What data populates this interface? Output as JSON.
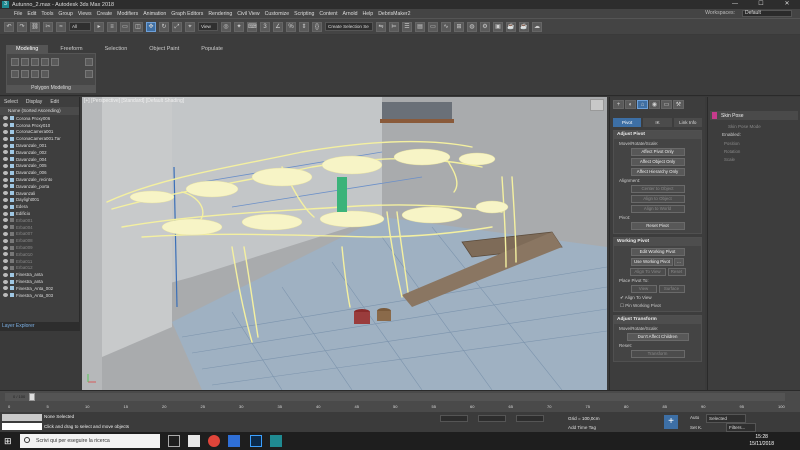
{
  "titlebar": {
    "app_icon": "3",
    "title": "Autunno_2.max - Autodesk 3ds Max 2018",
    "minimize": "—",
    "maximize": "☐",
    "close": "✕"
  },
  "menubar": {
    "items": [
      "File",
      "Edit",
      "Tools",
      "Group",
      "Views",
      "Create",
      "Modifiers",
      "Animation",
      "Graph Editors",
      "Rendering",
      "Civil View",
      "Customize",
      "Scripting",
      "Content",
      "Arnold",
      "Help",
      "DebrisMaker2"
    ],
    "workspaces_label": "Workspaces:",
    "workspace_value": "Default"
  },
  "maintoolbar": {
    "filter_value": "All",
    "view_value": "View",
    "selection_set_placeholder": "Create Selection Se"
  },
  "ribbon": {
    "tabs": [
      "Modeling",
      "Freeform",
      "Selection",
      "Object Paint",
      "Populate"
    ],
    "active_tab": "Modeling",
    "panel_label": "Polygon Modeling"
  },
  "scene_explorer": {
    "menu": [
      "Select",
      "Display",
      "Edit"
    ],
    "header": "Name (Sorted Ascending)",
    "items": [
      {
        "name": "Corona Proxy006",
        "dim": false
      },
      {
        "name": "Corona Proxy010",
        "dim": false
      },
      {
        "name": "CoronaCamera001",
        "dim": false
      },
      {
        "name": "CoronaCamera001.Tar",
        "dim": false
      },
      {
        "name": "Davanzale_001",
        "dim": false
      },
      {
        "name": "Davanzale_002",
        "dim": false
      },
      {
        "name": "Davanzale_004",
        "dim": false
      },
      {
        "name": "Davanzale_005",
        "dim": false
      },
      {
        "name": "Davanzale_006",
        "dim": false
      },
      {
        "name": "Davanzale_recinto",
        "dim": false
      },
      {
        "name": "Davanzale_porta",
        "dim": false
      },
      {
        "name": "Davanzali",
        "dim": false
      },
      {
        "name": "Daylight001",
        "dim": false
      },
      {
        "name": "Edera",
        "dim": false
      },
      {
        "name": "Edificio",
        "dim": false
      },
      {
        "name": "Erba001",
        "dim": true
      },
      {
        "name": "Erba004",
        "dim": true
      },
      {
        "name": "Erba007",
        "dim": true
      },
      {
        "name": "Erba008",
        "dim": true
      },
      {
        "name": "Erba009",
        "dim": true
      },
      {
        "name": "Erba010",
        "dim": true
      },
      {
        "name": "Erba011",
        "dim": true
      },
      {
        "name": "Erba012",
        "dim": true
      },
      {
        "name": "Finestra_anta",
        "dim": false
      },
      {
        "name": "Finestra_anta",
        "dim": false
      },
      {
        "name": "Finestra_Anta_002",
        "dim": false
      },
      {
        "name": "Finestra_Anta_003",
        "dim": false
      }
    ],
    "footer_label": "Layer Explorer"
  },
  "viewport": {
    "label": "[+] [Perspective] [Standard] [Default Shading]",
    "cube_label": "FRONT"
  },
  "command_panel": {
    "subtabs": [
      "Pivot",
      "IK",
      "Link Info"
    ],
    "active_subtab": "Pivot",
    "adjust_pivot": {
      "title": "Adjust Pivot",
      "move_label": "Move/Rotate/Scale:",
      "buttons": [
        "Affect Pivot Only",
        "Affect Object Only",
        "Affect Hierarchy Only"
      ],
      "alignment_label": "Alignment:",
      "align_buttons": [
        "Center to Object",
        "Align to Object",
        "Align to World"
      ],
      "pivot_label": "Pivot:",
      "reset_pivot": "Reset Pivot"
    },
    "working_pivot": {
      "title": "Working Pivot",
      "edit": "Edit Working Pivot",
      "use": "Use Working Pivot",
      "use_extra": "...",
      "align_to_view": "Align To View",
      "reset": "Reset",
      "place_label": "Place Pivot To:",
      "view": "View",
      "surface": "Surface",
      "chk_align": "Align To View",
      "pin": "Pin Working Pivot"
    },
    "adjust_transform": {
      "title": "Adjust Transform",
      "move_label": "Move/Rotate/Scale:",
      "dont_affect": "Don't Affect Children",
      "reset_label": "Reset:",
      "transform": "Transform"
    }
  },
  "skin_panel": {
    "title": "Skin Pose",
    "skin_pose_mode": "Skin Pose Mode",
    "enabled_label": "Enabled:",
    "options": [
      "Position",
      "Rotation",
      "Scale"
    ]
  },
  "timeline": {
    "frame_display": "0 / 100",
    "ticks": [
      "0",
      "5",
      "10",
      "15",
      "20",
      "25",
      "30",
      "35",
      "40",
      "45",
      "50",
      "55",
      "60",
      "65",
      "70",
      "75",
      "80",
      "85",
      "90",
      "95",
      "100"
    ]
  },
  "statusbar": {
    "selection": "None Selected",
    "hint": "Click and drag to select and move objects",
    "grid": "Grid = 100,0cm",
    "add_time_tag": "Add Time Tag",
    "auto": "Auto",
    "set_k": "Set K.",
    "selected_dd": "Selected",
    "filters": "Filters..."
  },
  "taskbar": {
    "search_placeholder": "Scrivi qui per eseguire la ricerca",
    "time": "15:28",
    "date": "15/11/2018"
  },
  "colors": {
    "accent": "#3d6fa5",
    "viewport_bg": "#a7a9ab",
    "wire_yellow": "#f4f0a0",
    "skin_swatch": "#c63b8c"
  }
}
